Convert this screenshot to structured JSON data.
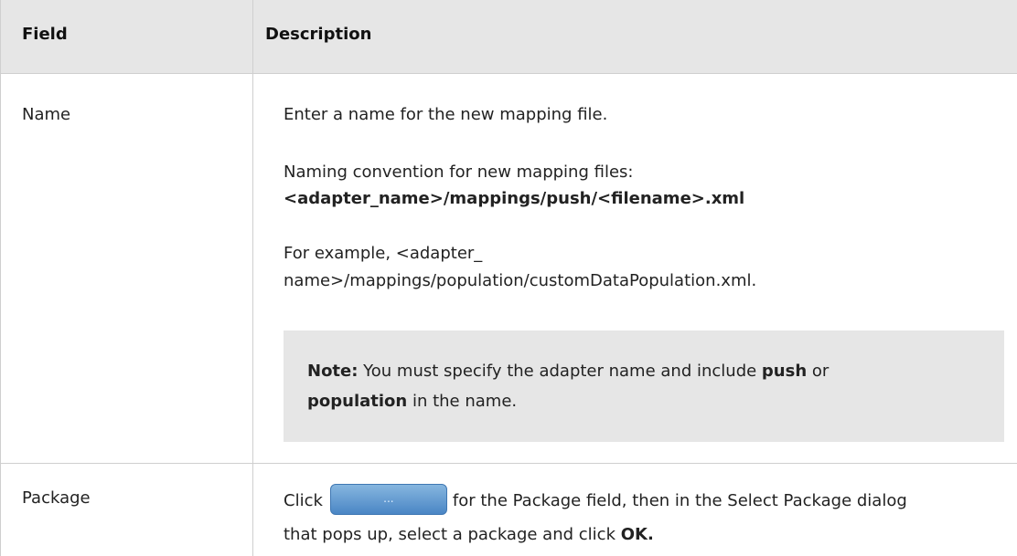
{
  "header": {
    "field": "Field",
    "description": "Description"
  },
  "rows": [
    {
      "field": "Name",
      "description_line1": "Enter a name for the new mapping file.",
      "naming_intro": "Naming convention for new mapping files:",
      "naming_pattern": "<adapter_name>/mappings/push/<filename>.xml",
      "example_line1": "For example, <adapter_",
      "example_line2": "name>/mappings/population/customDataPopulation.xml.",
      "note": {
        "label": "Note:",
        "text1": " You must specify the adapter name and include ",
        "kw1": "push",
        "text2": " or",
        "kw2": "population",
        "text3": " in the name."
      }
    },
    {
      "field": "Package",
      "click": "Click",
      "button_label": "...",
      "after_button": "for the Package field, then in the Select Package dialog",
      "line2": "that pops up, select a package and click ",
      "ok": "OK."
    }
  ]
}
